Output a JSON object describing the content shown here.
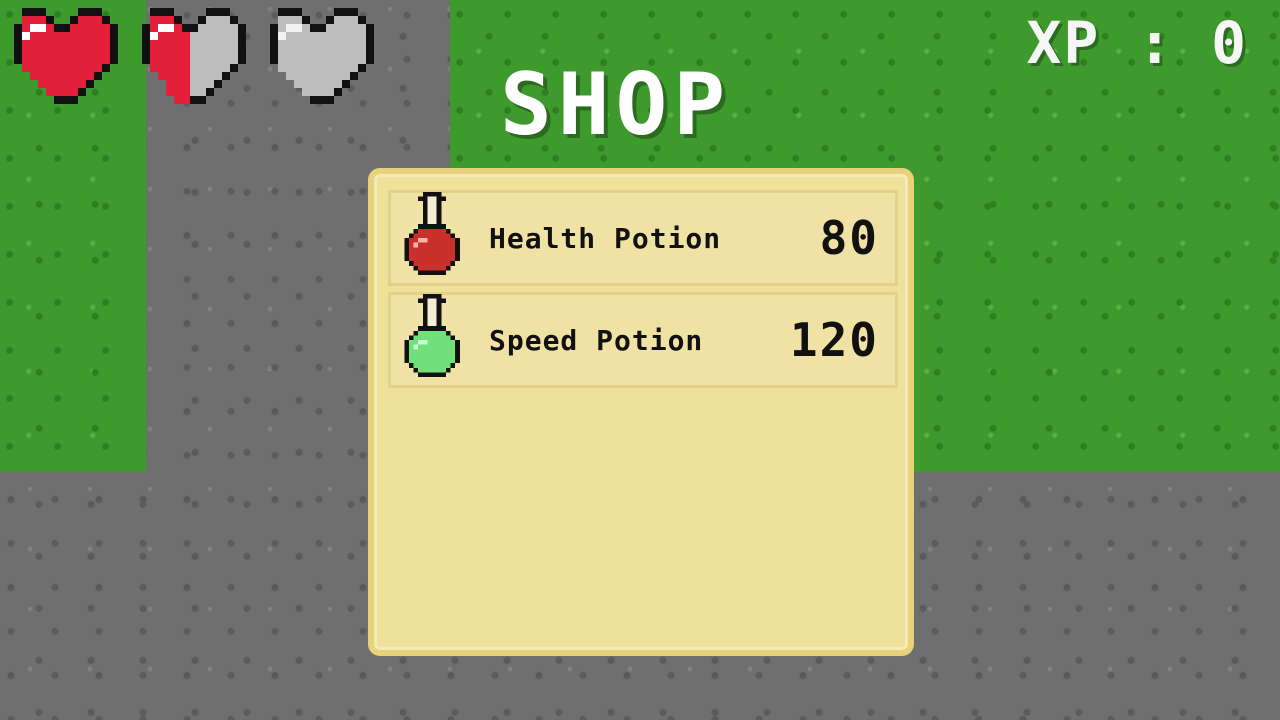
{
  "hud": {
    "hearts": [
      {
        "state": "full"
      },
      {
        "state": "half"
      },
      {
        "state": "empty"
      }
    ],
    "xp_text": "XP : 0"
  },
  "shop": {
    "title": "SHOP",
    "items": [
      {
        "name": "Health Potion",
        "price": "80",
        "potion_icon": "red-potion-icon"
      },
      {
        "name": "Speed Potion",
        "price": "120",
        "potion_icon": "green-potion-icon"
      }
    ]
  },
  "colors": {
    "grass": "#3f9a2e",
    "stone": "#6f6f6f",
    "panel": "#f0e19a",
    "heart_red": "#e3203b",
    "heart_empty": "#bdbdbd",
    "potion_red": "#c9302c",
    "potion_green": "#6fe07a"
  }
}
